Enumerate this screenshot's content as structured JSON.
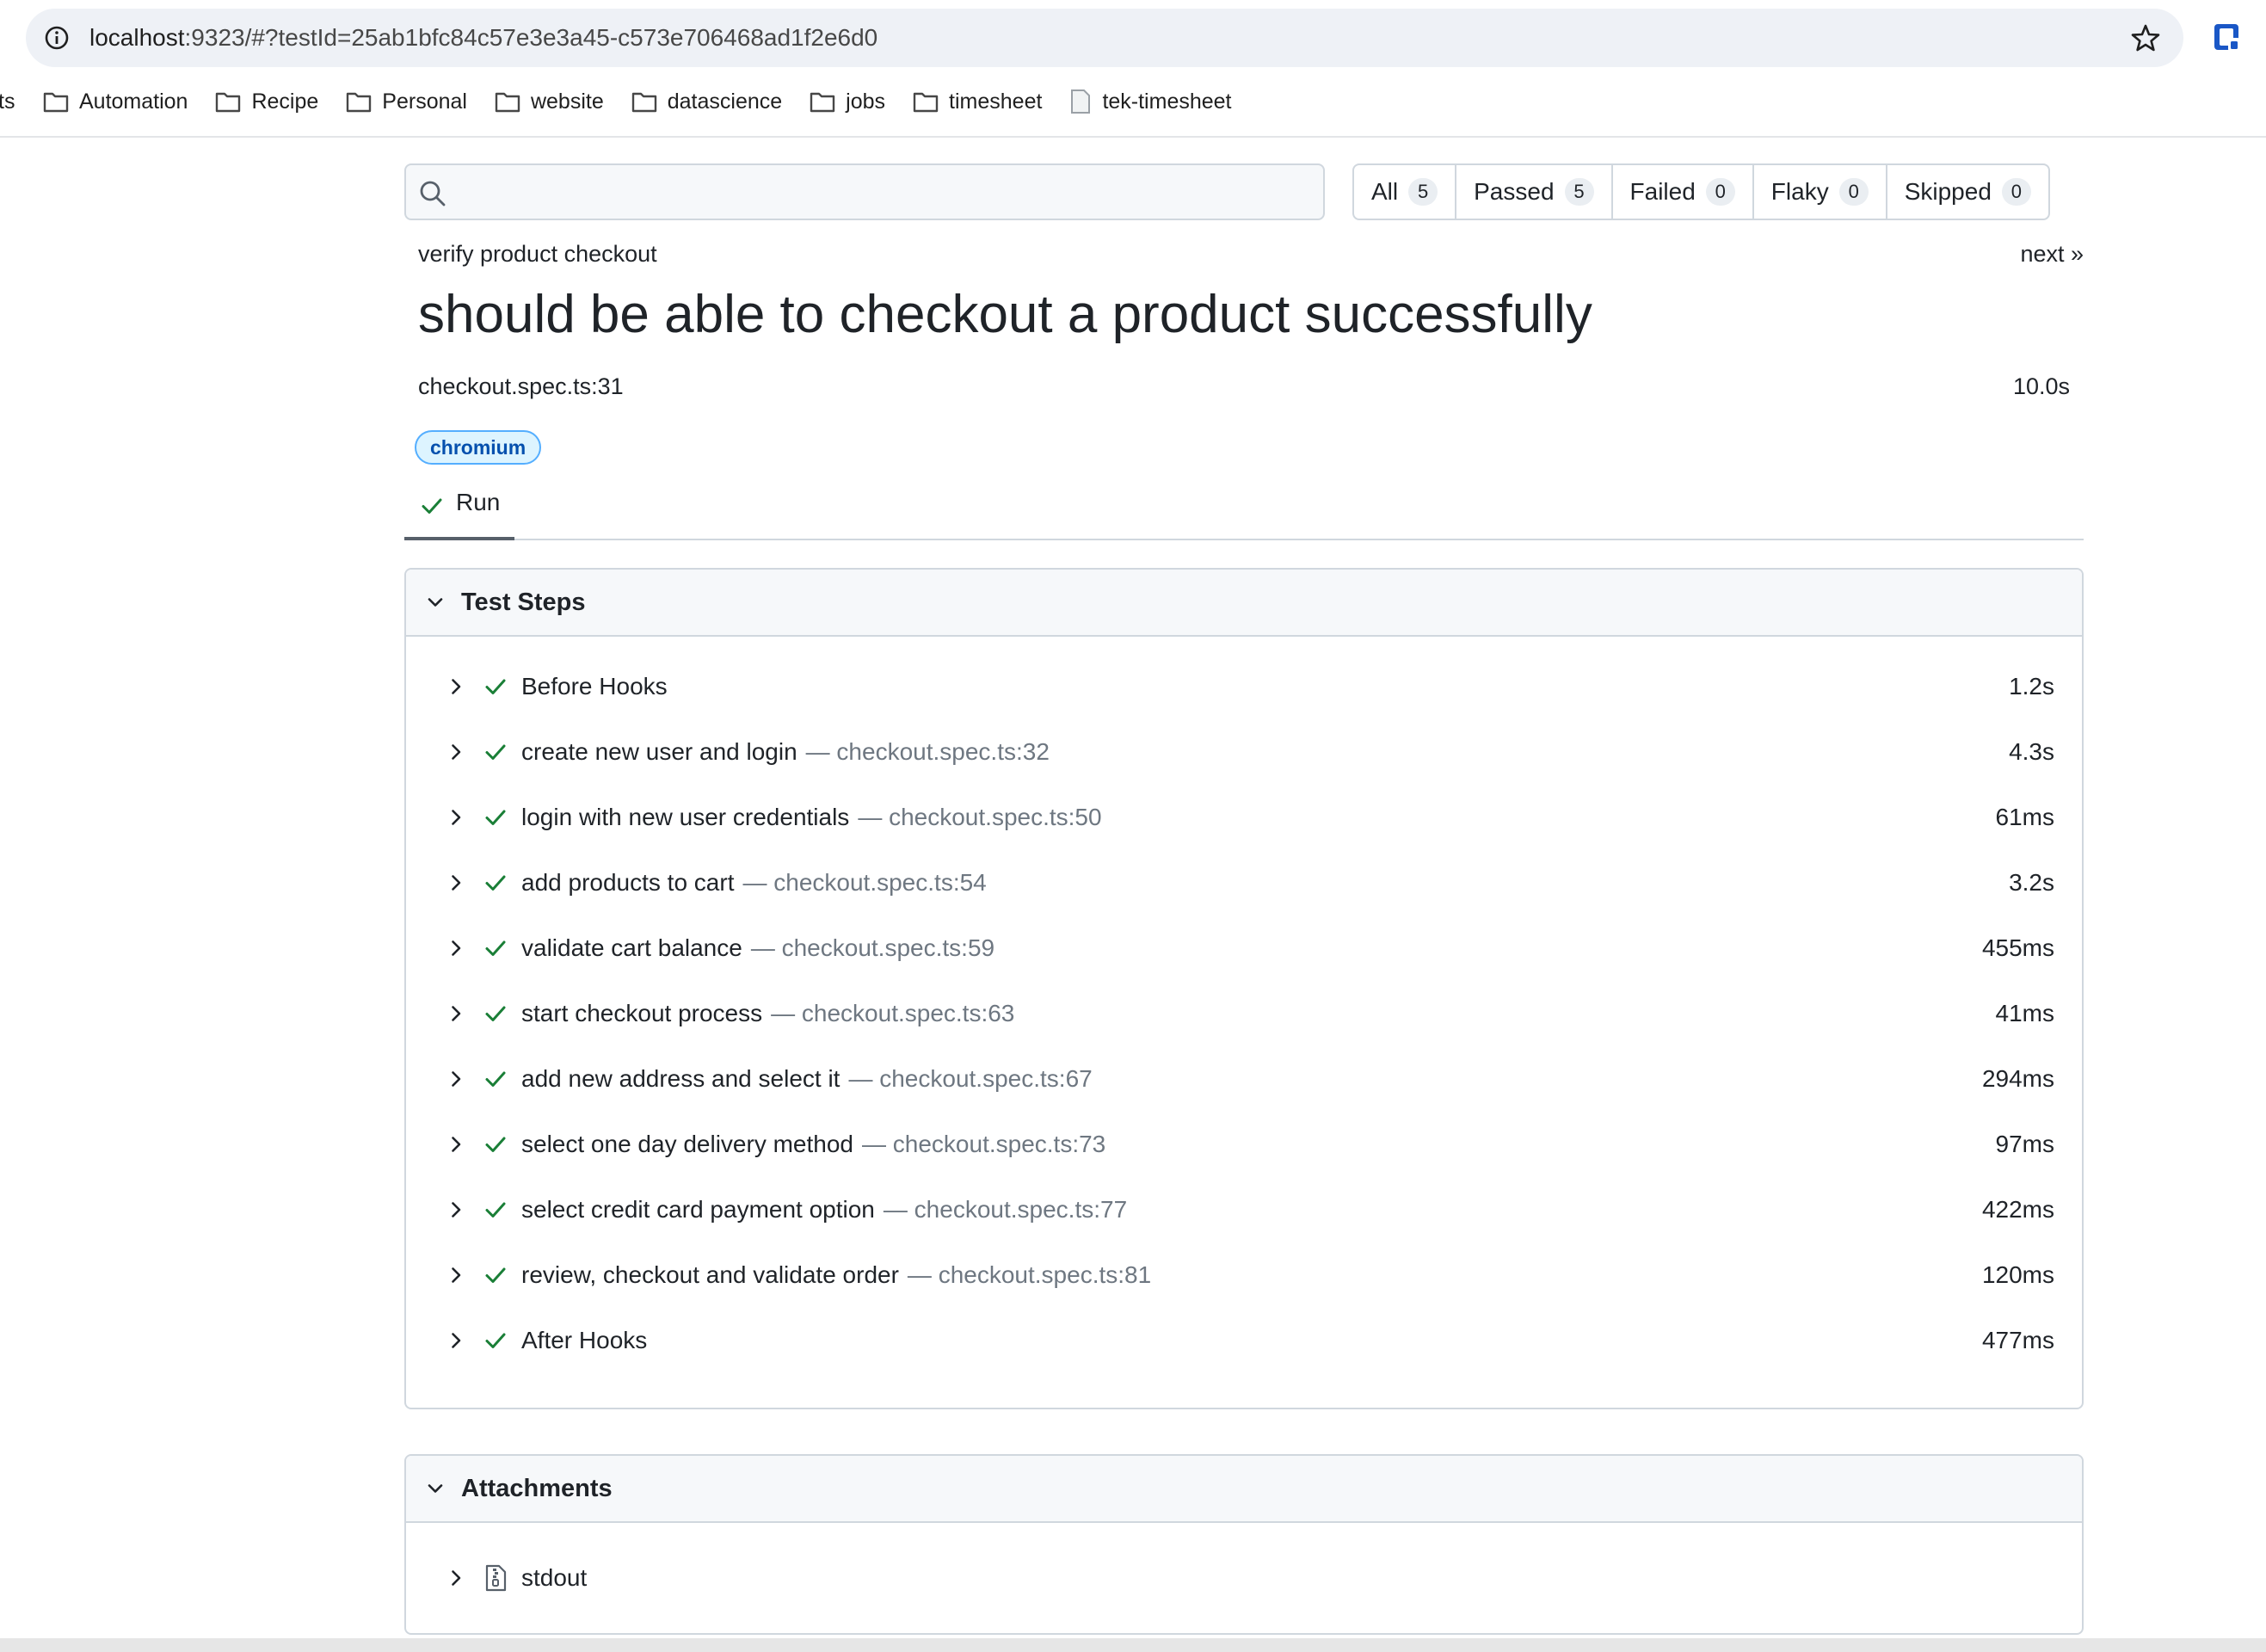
{
  "browser": {
    "url_host": "localhost",
    "url_rest": ":9323/#?testId=25ab1bfc84c57e3e3a45-c573e706468ad1f2e6d0",
    "bookmarks_cut": "ts",
    "bookmarks": [
      {
        "label": "Automation",
        "icon": "folder-icon"
      },
      {
        "label": "Recipe",
        "icon": "folder-icon"
      },
      {
        "label": "Personal",
        "icon": "folder-icon"
      },
      {
        "label": "website",
        "icon": "folder-icon"
      },
      {
        "label": "datascience",
        "icon": "folder-icon"
      },
      {
        "label": "jobs",
        "icon": "folder-icon"
      },
      {
        "label": "timesheet",
        "icon": "folder-icon"
      },
      {
        "label": "tek-timesheet",
        "icon": "page-icon"
      }
    ]
  },
  "search": {
    "placeholder": "",
    "value": ""
  },
  "filters": [
    {
      "label": "All",
      "count": "5"
    },
    {
      "label": "Passed",
      "count": "5"
    },
    {
      "label": "Failed",
      "count": "0"
    },
    {
      "label": "Flaky",
      "count": "0"
    },
    {
      "label": "Skipped",
      "count": "0"
    }
  ],
  "test": {
    "suite": "verify product checkout",
    "next_label": "next »",
    "title": "should be able to checkout a product successfully",
    "location": "checkout.spec.ts:31",
    "duration": "10.0s",
    "project": "chromium"
  },
  "tabs": {
    "run_label": "Run"
  },
  "steps_panel": {
    "title": "Test Steps",
    "steps": [
      {
        "label": "Before Hooks",
        "location": "",
        "duration": "1.2s"
      },
      {
        "label": "create new user and login",
        "location": "— checkout.spec.ts:32",
        "duration": "4.3s"
      },
      {
        "label": "login with new user credentials",
        "location": "— checkout.spec.ts:50",
        "duration": "61ms"
      },
      {
        "label": "add products to cart",
        "location": "— checkout.spec.ts:54",
        "duration": "3.2s"
      },
      {
        "label": "validate cart balance",
        "location": "— checkout.spec.ts:59",
        "duration": "455ms"
      },
      {
        "label": "start checkout process",
        "location": "— checkout.spec.ts:63",
        "duration": "41ms"
      },
      {
        "label": "add new address and select it",
        "location": "— checkout.spec.ts:67",
        "duration": "294ms"
      },
      {
        "label": "select one day delivery method",
        "location": "— checkout.spec.ts:73",
        "duration": "97ms"
      },
      {
        "label": "select credit card payment option",
        "location": "— checkout.spec.ts:77",
        "duration": "422ms"
      },
      {
        "label": "review, checkout and validate order",
        "location": "— checkout.spec.ts:81",
        "duration": "120ms"
      },
      {
        "label": "After Hooks",
        "location": "",
        "duration": "477ms"
      }
    ]
  },
  "attachments_panel": {
    "title": "Attachments",
    "items": [
      {
        "label": "stdout",
        "icon": "file-zip-icon"
      }
    ]
  },
  "colors": {
    "pass_green": "#1a7f37",
    "tag_blue": "#0550ae",
    "border": "#d0d7de"
  }
}
